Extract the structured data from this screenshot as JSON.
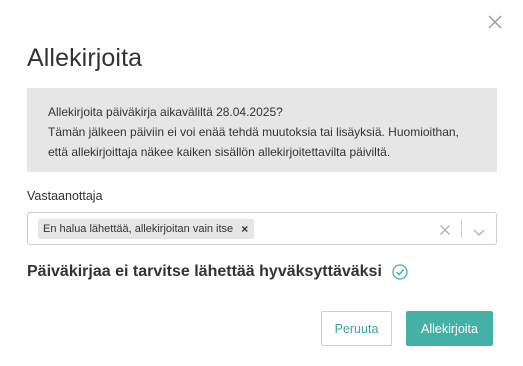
{
  "dialog": {
    "title": "Allekirjoita",
    "close_icon": "close-icon"
  },
  "info": {
    "line1": "Allekirjoita päiväkirja aikaväliltä 28.04.2025?",
    "line2": "Tämän jälkeen päiviin ei voi enää tehdä muutoksia tai lisäyksiä. Huomioithan,",
    "line3": "että allekirjoittaja näkee kaiken sisällön allekirjoitettavilta päiviltä."
  },
  "recipient": {
    "label": "Vastaanottaja",
    "selected_chip": "En halua lähettää, allekirjoitan vain itse",
    "chip_remove": "×",
    "icons": [
      "close-icon",
      "chevron-down-icon"
    ]
  },
  "status": {
    "text": "Päiväkirjaa ei tarvitse lähettää hyväksyttäväksi",
    "icon": "check-circle-icon"
  },
  "buttons": {
    "cancel_label": "Peruuta",
    "sign_label": "Allekirjoita"
  },
  "colors": {
    "accent": "#45b1a6",
    "info_background": "#e6e6e6",
    "text": "#333333",
    "border": "#cccccc"
  }
}
